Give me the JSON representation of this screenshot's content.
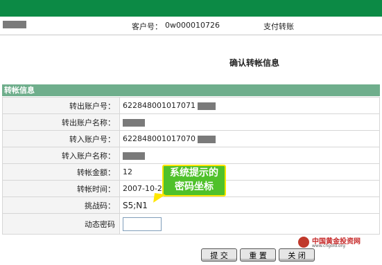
{
  "header": {
    "customer_label": "客户号：",
    "customer_value": "0w000010726",
    "service": "支付转账"
  },
  "confirm_title": "确认转帐信息",
  "panel": {
    "title": "转帐信息",
    "rows": {
      "out_account_label": "转出账户号：",
      "out_account_value": "622848001017071",
      "out_name_label": "转出账户名称：",
      "in_account_label": "转入账户号：",
      "in_account_value": "622848001017070",
      "in_name_label": "转入账户名称：",
      "amount_label": "转帐金额：",
      "amount_value": "12",
      "time_label": "转帐时间：",
      "time_value": "2007-10-22",
      "challenge_label": "挑战码：",
      "challenge_value": "S5;N1",
      "dynamic_pw_label": "动态密码"
    }
  },
  "callout": {
    "line1": "系统提示的",
    "line2": "密码坐标",
    "color": "#4fc12a"
  },
  "buttons": {
    "submit": "提 交",
    "reset": "重 置",
    "close": "关 闭"
  },
  "logo": {
    "name": "中国黄金投资网",
    "url": "www.cngold.org"
  },
  "colors": {
    "top_bar": "#0c8a45",
    "panel_header": "#6fae8c"
  }
}
